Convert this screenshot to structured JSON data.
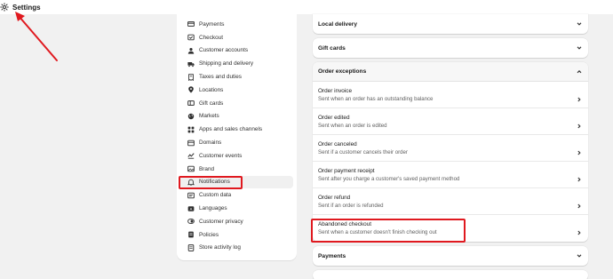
{
  "topbar": {
    "title": "Settings",
    "icon": "gear-icon"
  },
  "sidebar": {
    "items": [
      {
        "label": "Payments",
        "icon": "payments-icon"
      },
      {
        "label": "Checkout",
        "icon": "checkout-icon"
      },
      {
        "label": "Customer accounts",
        "icon": "person-icon"
      },
      {
        "label": "Shipping and delivery",
        "icon": "truck-icon"
      },
      {
        "label": "Taxes and duties",
        "icon": "receipt-icon"
      },
      {
        "label": "Locations",
        "icon": "location-pin-icon"
      },
      {
        "label": "Gift cards",
        "icon": "gift-card-icon"
      },
      {
        "label": "Markets",
        "icon": "globe-icon"
      },
      {
        "label": "Apps and sales channels",
        "icon": "apps-icon"
      },
      {
        "label": "Domains",
        "icon": "domain-icon"
      },
      {
        "label": "Customer events",
        "icon": "events-icon"
      },
      {
        "label": "Brand",
        "icon": "brand-icon"
      },
      {
        "label": "Notifications",
        "icon": "bell-icon",
        "active": true
      },
      {
        "label": "Custom data",
        "icon": "custom-data-icon"
      },
      {
        "label": "Languages",
        "icon": "languages-icon"
      },
      {
        "label": "Customer privacy",
        "icon": "privacy-icon"
      },
      {
        "label": "Policies",
        "icon": "policies-icon"
      },
      {
        "label": "Store activity log",
        "icon": "activity-log-icon"
      }
    ]
  },
  "main": {
    "local_delivery": "Local delivery",
    "gift_cards": "Gift cards",
    "order_exceptions": {
      "title": "Order exceptions",
      "rows": [
        {
          "title": "Order invoice",
          "desc": "Sent when an order has an outstanding balance"
        },
        {
          "title": "Order edited",
          "desc": "Sent when an order is edited"
        },
        {
          "title": "Order canceled",
          "desc": "Sent if a customer cancels their order"
        },
        {
          "title": "Order payment receipt",
          "desc": "Sent after you charge a customer's saved payment method"
        },
        {
          "title": "Order refund",
          "desc": "Sent if an order is refunded"
        },
        {
          "title": "Abandoned checkout",
          "desc": "Sent when a customer doesn't finish checking out"
        }
      ]
    },
    "payments": "Payments"
  },
  "colors": {
    "annotation": "#e0191f",
    "active_bg": "#f0f0f0",
    "page_bg": "#f1f1f1"
  }
}
